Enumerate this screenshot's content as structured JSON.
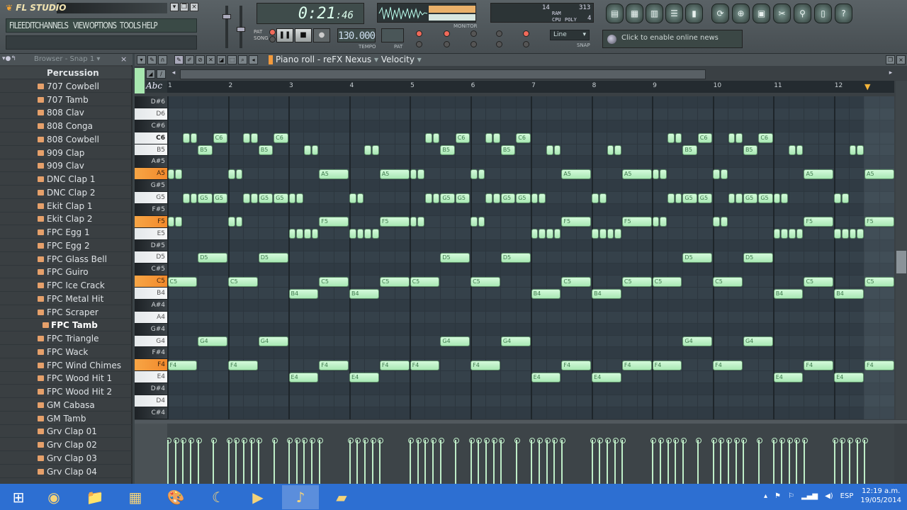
{
  "app": {
    "title": "FL STUDIO"
  },
  "menu": [
    "FILE",
    "EDIT",
    "CHANNELS",
    "VIEW",
    "OPTIONS",
    "TOOLS",
    "HELP"
  ],
  "transport": {
    "time_main": "0:21",
    "time_sub": ":46",
    "tempo": "130.000",
    "tempo_label": "TEMPO",
    "pat_label": "PAT",
    "pat_song": [
      "PAT",
      "SONG"
    ],
    "pause_icon": "pause-icon",
    "stop_icon": "stop-icon",
    "record_icon": "record-icon"
  },
  "monitor": {
    "label": "MONITOR",
    "cpu_value": "14",
    "ram_value": "313",
    "poly_value": "4",
    "ram_label": "RAM",
    "cpu_label": "CPU",
    "poly_label": "POLY"
  },
  "snap": {
    "value": "Line",
    "label": "SNAP"
  },
  "news": {
    "text": "Click to enable online news"
  },
  "toolbar_icons": [
    "playlist-icon",
    "step-sequencer-icon",
    "piano-roll-icon",
    "browser-icon",
    "mixer-icon",
    "undo-icon",
    "save-new-icon",
    "save-icon",
    "cut-icon",
    "record-audio-icon",
    "project-info-icon",
    "help-icon"
  ],
  "browser": {
    "title": "Browser - Snap 1",
    "folder": "Percussion",
    "selected": "FPC Tamb",
    "items": [
      "707 Cowbell",
      "707 Tamb",
      "808 Clav",
      "808 Conga",
      "808 Cowbell",
      "909 Clap",
      "909 Clav",
      "DNC Clap 1",
      "DNC Clap 2",
      "Ekit Clap 1",
      "Ekit Clap 2",
      "FPC Egg 1",
      "FPC Egg 2",
      "FPC Glass Bell",
      "FPC Guiro",
      "FPC Ice Crack",
      "FPC Metal Hit",
      "FPC Scraper",
      "FPC Tamb",
      "FPC Triangle",
      "FPC Wack",
      "FPC Wind Chimes",
      "FPC Wood Hit 1",
      "FPC Wood Hit 2",
      "GM Cabasa",
      "GM Tamb",
      "Grv Clap 01",
      "Grv Clap 02",
      "Grv Clap 03",
      "Grv Clap 04"
    ]
  },
  "piano_roll": {
    "title": "Piano roll - reFX Nexus",
    "separator": "-",
    "control": "Velocity",
    "abc_label": "Abc",
    "bars": [
      "1",
      "2",
      "3",
      "4",
      "5",
      "6",
      "7",
      "8",
      "9",
      "10",
      "11",
      "12"
    ],
    "keys": [
      "D#6",
      "D6",
      "C#6",
      "C6",
      "B5",
      "A#5",
      "A5",
      "G#5",
      "G5",
      "F#5",
      "F5",
      "E5",
      "D#5",
      "D5",
      "C#5",
      "C5",
      "B4",
      "A#4",
      "A4",
      "G#4",
      "G4",
      "F#4",
      "F4",
      "E4",
      "D#4",
      "D4",
      "C#4"
    ],
    "highlighted_keys": [
      "A5",
      "F5",
      "C5",
      "F4"
    ],
    "note_color": "#b8f0c2",
    "steps_per_bar": 8,
    "pattern_length_bars": 4,
    "pattern_repeats": 3,
    "pattern": [
      {
        "key": "C6",
        "start": 2,
        "len": 1
      },
      {
        "key": "C6",
        "start": 3,
        "len": 1
      },
      {
        "key": "C6",
        "start": 6,
        "len": 2,
        "label": "C6"
      },
      {
        "key": "C6",
        "start": 10,
        "len": 1
      },
      {
        "key": "C6",
        "start": 11,
        "len": 1
      },
      {
        "key": "C6",
        "start": 14,
        "len": 2,
        "label": "C6"
      },
      {
        "key": "B5",
        "start": 4,
        "len": 2,
        "label": "B5"
      },
      {
        "key": "B5",
        "start": 12,
        "len": 2,
        "label": "B5"
      },
      {
        "key": "B5",
        "start": 18,
        "len": 1
      },
      {
        "key": "B5",
        "start": 19,
        "len": 1
      },
      {
        "key": "B5",
        "start": 26,
        "len": 1
      },
      {
        "key": "B5",
        "start": 27,
        "len": 1
      },
      {
        "key": "A5",
        "start": 0,
        "len": 1
      },
      {
        "key": "A5",
        "start": 1,
        "len": 1
      },
      {
        "key": "A5",
        "start": 8,
        "len": 1
      },
      {
        "key": "A5",
        "start": 9,
        "len": 1
      },
      {
        "key": "A5",
        "start": 20,
        "len": 4,
        "label": "A5"
      },
      {
        "key": "A5",
        "start": 28,
        "len": 4,
        "label": "A5"
      },
      {
        "key": "G5",
        "start": 2,
        "len": 1
      },
      {
        "key": "G5",
        "start": 3,
        "len": 1
      },
      {
        "key": "G5",
        "start": 4,
        "len": 2,
        "label": "G5"
      },
      {
        "key": "G5",
        "start": 6,
        "len": 2,
        "label": "G5"
      },
      {
        "key": "G5",
        "start": 10,
        "len": 1
      },
      {
        "key": "G5",
        "start": 11,
        "len": 1
      },
      {
        "key": "G5",
        "start": 12,
        "len": 2,
        "label": "G5"
      },
      {
        "key": "G5",
        "start": 14,
        "len": 2,
        "label": "G5"
      },
      {
        "key": "G5",
        "start": 16,
        "len": 1
      },
      {
        "key": "G5",
        "start": 17,
        "len": 1
      },
      {
        "key": "G5",
        "start": 24,
        "len": 1
      },
      {
        "key": "G5",
        "start": 25,
        "len": 1
      },
      {
        "key": "F5",
        "start": 0,
        "len": 1
      },
      {
        "key": "F5",
        "start": 1,
        "len": 1
      },
      {
        "key": "F5",
        "start": 8,
        "len": 1
      },
      {
        "key": "F5",
        "start": 9,
        "len": 1
      },
      {
        "key": "F5",
        "start": 20,
        "len": 4,
        "label": "F5"
      },
      {
        "key": "F5",
        "start": 28,
        "len": 4,
        "label": "F5"
      },
      {
        "key": "E5",
        "start": 16,
        "len": 1
      },
      {
        "key": "E5",
        "start": 17,
        "len": 1
      },
      {
        "key": "E5",
        "start": 18,
        "len": 1
      },
      {
        "key": "E5",
        "start": 19,
        "len": 1
      },
      {
        "key": "E5",
        "start": 24,
        "len": 1
      },
      {
        "key": "E5",
        "start": 25,
        "len": 1
      },
      {
        "key": "E5",
        "start": 26,
        "len": 1
      },
      {
        "key": "E5",
        "start": 27,
        "len": 1
      },
      {
        "key": "D5",
        "start": 4,
        "len": 4,
        "label": "D5"
      },
      {
        "key": "D5",
        "start": 12,
        "len": 4,
        "label": "D5"
      },
      {
        "key": "C5",
        "start": 0,
        "len": 4,
        "label": "C5"
      },
      {
        "key": "C5",
        "start": 8,
        "len": 4,
        "label": "C5"
      },
      {
        "key": "C5",
        "start": 20,
        "len": 4,
        "label": "C5"
      },
      {
        "key": "C5",
        "start": 28,
        "len": 4,
        "label": "C5"
      },
      {
        "key": "B4",
        "start": 16,
        "len": 4,
        "label": "B4"
      },
      {
        "key": "B4",
        "start": 24,
        "len": 4,
        "label": "B4"
      },
      {
        "key": "G4",
        "start": 4,
        "len": 4,
        "label": "G4"
      },
      {
        "key": "G4",
        "start": 12,
        "len": 4,
        "label": "G4"
      },
      {
        "key": "F4",
        "start": 0,
        "len": 4,
        "label": "F4"
      },
      {
        "key": "F4",
        "start": 8,
        "len": 4,
        "label": "F4"
      },
      {
        "key": "F4",
        "start": 20,
        "len": 4,
        "label": "F4"
      },
      {
        "key": "F4",
        "start": 28,
        "len": 4,
        "label": "F4"
      },
      {
        "key": "E4",
        "start": 16,
        "len": 4,
        "label": "E4"
      },
      {
        "key": "E4",
        "start": 24,
        "len": 4,
        "label": "E4"
      }
    ]
  },
  "taskbar": {
    "apps": [
      {
        "name": "start",
        "glyph": "⊞"
      },
      {
        "name": "chrome",
        "glyph": "◉"
      },
      {
        "name": "file-explorer",
        "glyph": "📁"
      },
      {
        "name": "calculator",
        "glyph": "▦"
      },
      {
        "name": "paint",
        "glyph": "🎨"
      },
      {
        "name": "app-c",
        "glyph": "☾"
      },
      {
        "name": "media-player",
        "glyph": "▶"
      },
      {
        "name": "fl-studio",
        "glyph": "♪"
      },
      {
        "name": "sticky-notes",
        "glyph": "▰"
      }
    ],
    "active": "fl-studio",
    "language": "ESP",
    "time": "12:19 a.m.",
    "date": "19/05/2014",
    "color": "#2d6fd2"
  }
}
